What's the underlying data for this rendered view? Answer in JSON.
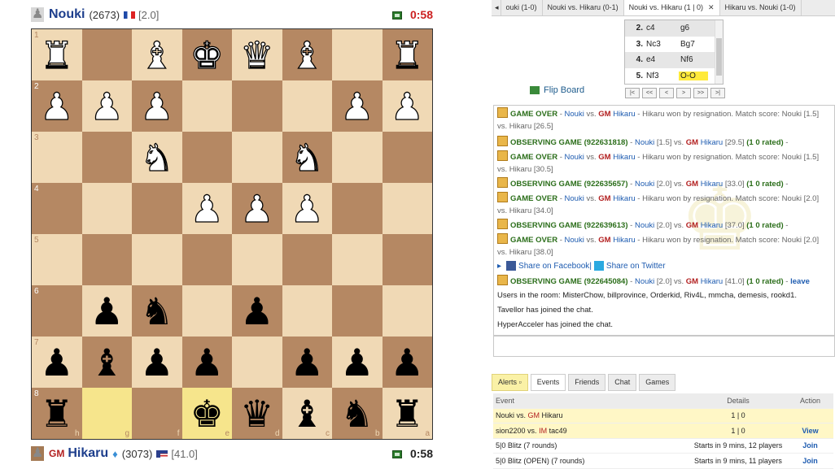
{
  "top_player": {
    "name": "Nouki",
    "rating": "(2673)",
    "score": "[2.0]",
    "clock": "0:58",
    "clock_color": "#cc1f1f"
  },
  "bottom_player": {
    "title": "GM",
    "name": "Hikaru",
    "rating": "(3073)",
    "score": "[41.0]",
    "clock": "0:58",
    "clock_color": "#222222"
  },
  "board": {
    "ranks": [
      "1",
      "2",
      "3",
      "4",
      "5",
      "6",
      "7",
      "8"
    ],
    "files": [
      "h",
      "g",
      "f",
      "e",
      "d",
      "c",
      "b",
      "a"
    ],
    "highlight": [
      "g8",
      "e8"
    ],
    "pieces": [
      [
        "wR",
        "",
        "wB",
        "wK",
        "wQ",
        "wB",
        "",
        "wR"
      ],
      [
        "wP",
        "wP",
        "wP",
        "",
        "",
        "",
        "wP",
        "wP"
      ],
      [
        "",
        "",
        "wN",
        "",
        "",
        "wN",
        "",
        ""
      ],
      [
        "",
        "",
        "",
        "wP",
        "wP",
        "wP",
        "",
        ""
      ],
      [
        "",
        "",
        "",
        "",
        "",
        "",
        "",
        ""
      ],
      [
        "",
        "bP",
        "bN",
        "",
        "bP",
        "",
        "",
        ""
      ],
      [
        "bP",
        "bB",
        "bP",
        "bP",
        "",
        "bP",
        "bP",
        "bP"
      ],
      [
        "bR",
        "",
        "",
        "bK",
        "bQ",
        "bB",
        "bN",
        "bR"
      ]
    ],
    "glyphs": {
      "K": "♚",
      "Q": "♛",
      "R": "♜",
      "B": "♝",
      "N": "♞",
      "P": "♟"
    }
  },
  "game_tabs": [
    {
      "label": "ouki (1-0)",
      "closable": false,
      "active": false
    },
    {
      "label": "Nouki vs. Hikaru (0-1)",
      "closable": false,
      "active": false
    },
    {
      "label": "Nouki vs. Hikaru (1 | 0)",
      "closable": true,
      "active": true
    },
    {
      "label": "Hikaru vs. Nouki (1-0)",
      "closable": false,
      "active": false
    }
  ],
  "moves": [
    {
      "num": "2.",
      "white": "c4",
      "black": "g6",
      "current": false
    },
    {
      "num": "3.",
      "white": "Nc3",
      "black": "Bg7",
      "current": false
    },
    {
      "num": "4.",
      "white": "e4",
      "black": "Nf6",
      "current": false
    },
    {
      "num": "5.",
      "white": "Nf3",
      "black": "O-O",
      "current": true
    }
  ],
  "flip_board_label": "Flip Board",
  "nav_buttons": [
    "|<",
    "<<",
    "<",
    ">",
    ">>",
    ">|"
  ],
  "chat": [
    {
      "type": "over",
      "a": "GAME OVER",
      "b": " - ",
      "p1": "Nouki",
      "vs": " vs. ",
      "gm": "GM",
      "p2": "Hikaru",
      "rest": " - Hikaru won by resignation. Match score: Nouki [1.5]",
      "line2": "vs. Hikaru [26.5]"
    },
    {
      "type": "obs",
      "a": "OBSERVING GAME (922631818)",
      "b": " - ",
      "p1": "Nouki",
      "s1": " [1.5] vs. ",
      "gm": "GM",
      "p2": "Hikaru",
      "rest": " [29.5]",
      "tail": " (1 0 rated)",
      "end": " -"
    },
    {
      "type": "over",
      "a": "GAME OVER",
      "b": " - ",
      "p1": "Nouki",
      "vs": " vs. ",
      "gm": "GM",
      "p2": "Hikaru",
      "rest": " - Hikaru won by resignation. Match score: Nouki [1.5]",
      "line2": "vs. Hikaru [30.5]"
    },
    {
      "type": "obs",
      "a": "OBSERVING GAME (922635657)",
      "b": " - ",
      "p1": "Nouki",
      "s1": " [2.0] vs. ",
      "gm": "GM",
      "p2": "Hikaru",
      "rest": " [33.0]",
      "tail": " (1 0 rated)",
      "end": " -"
    },
    {
      "type": "over",
      "a": "GAME OVER",
      "b": " - ",
      "p1": "Nouki",
      "vs": " vs. ",
      "gm": "GM",
      "p2": "Hikaru",
      "rest": " - Hikaru won by resignation. Match score: Nouki [2.0]",
      "line2": "vs. Hikaru [34.0]"
    },
    {
      "type": "obs",
      "a": "OBSERVING GAME (922639613)",
      "b": " - ",
      "p1": "Nouki",
      "s1": " [2.0] vs. ",
      "gm": "GM",
      "p2": "Hikaru",
      "rest": " [37.0]",
      "tail": " (1 0 rated)",
      "end": " -"
    },
    {
      "type": "over",
      "a": "GAME OVER",
      "b": " - ",
      "p1": "Nouki",
      "vs": " vs. ",
      "gm": "GM",
      "p2": "Hikaru",
      "rest": " - Hikaru won by resignation. Match score: Nouki [2.0]",
      "line2": "vs. Hikaru [38.0]"
    },
    {
      "type": "obs",
      "a": "OBSERVING GAME (922645084)",
      "b": " - ",
      "p1": "Nouki",
      "s1": " [2.0] vs. ",
      "gm": "GM",
      "p2": "Hikaru",
      "rest": " [41.0]",
      "tail": " (1 0 rated)",
      "end": " - ",
      "leave": "leave"
    }
  ],
  "share": {
    "facebook": "Share on Facebook",
    "separator": "|",
    "twitter": "Share on Twitter"
  },
  "room_users": "Users in the room: MisterChow, billprovince, Orderkid, Riv4L, mmcha, demesis, rookd1.",
  "joined": [
    "Tavellor has joined the chat.",
    "HyperAcceler has joined the chat."
  ],
  "bottom_tabs": [
    "Alerts",
    "Events",
    "Friends",
    "Chat",
    "Games"
  ],
  "events": {
    "headers": [
      "Event",
      "Details",
      "Action"
    ],
    "rows": [
      {
        "p1": "Nouki",
        "vs": " vs. ",
        "title": "GM",
        "p2": "Hikaru",
        "details": "1 | 0",
        "action": "",
        "yellow": true
      },
      {
        "p1": "sion2200",
        "vs": " vs. ",
        "title": "IM",
        "p2": "tac49",
        "details": "1 | 0",
        "action": "View",
        "yellow": true
      },
      {
        "p1": "5|0 Blitz (7 rounds)",
        "vs": "",
        "title": "",
        "p2": "",
        "details": "Starts in 9 mins, 12 players",
        "action": "Join",
        "yellow": false
      },
      {
        "p1": "5|0 Blitz (OPEN) (7 rounds)",
        "vs": "",
        "title": "",
        "p2": "",
        "details": "Starts in 9 mins, 11 players",
        "action": "Join",
        "yellow": false
      }
    ]
  }
}
